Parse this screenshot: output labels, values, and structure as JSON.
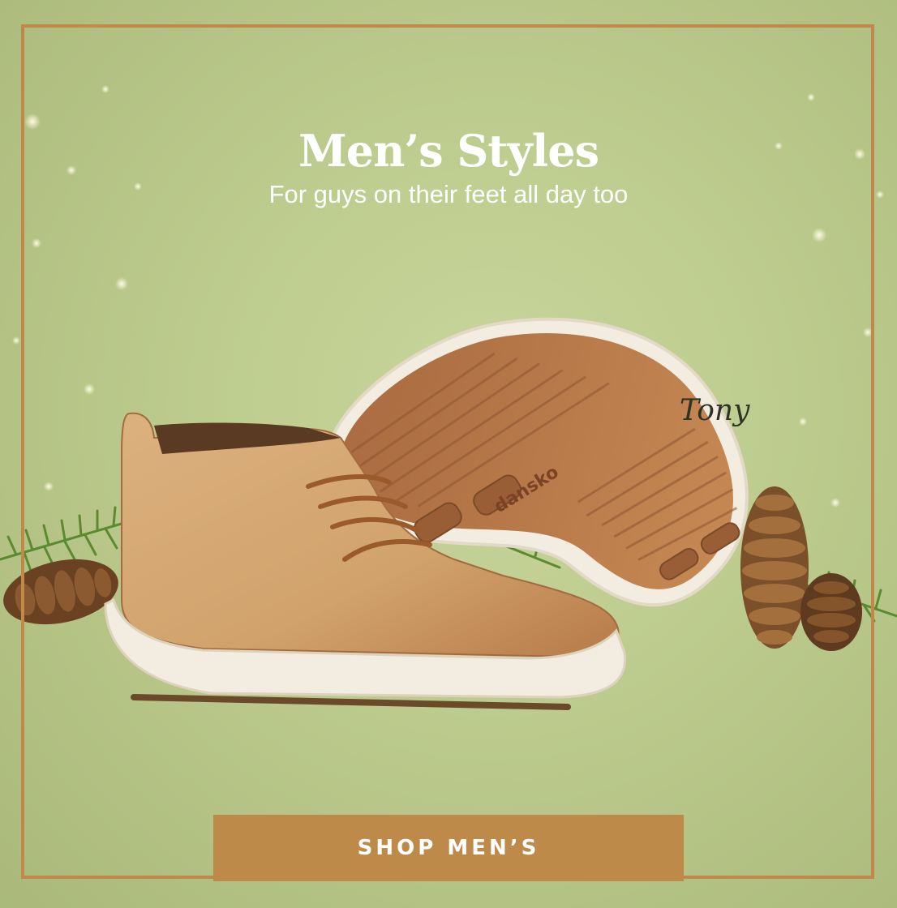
{
  "banner": {
    "headline": "Men’s Styles",
    "subhead": "For guys on their feet all day too",
    "signature": "Tony",
    "sole_brand": "dansko",
    "cta_label": "SHOP MEN’S"
  },
  "colors": {
    "background": "#bccb8d",
    "frame": "#c0894b",
    "cta_background": "#be8a4a",
    "shoe_leather": "#d2a46e",
    "sole_rubber": "#b9784a",
    "midsole": "#f2ede0"
  },
  "icons": [
    "sparkle",
    "pine-branch",
    "pine-cone",
    "chukka-boot",
    "shoe-sole"
  ]
}
